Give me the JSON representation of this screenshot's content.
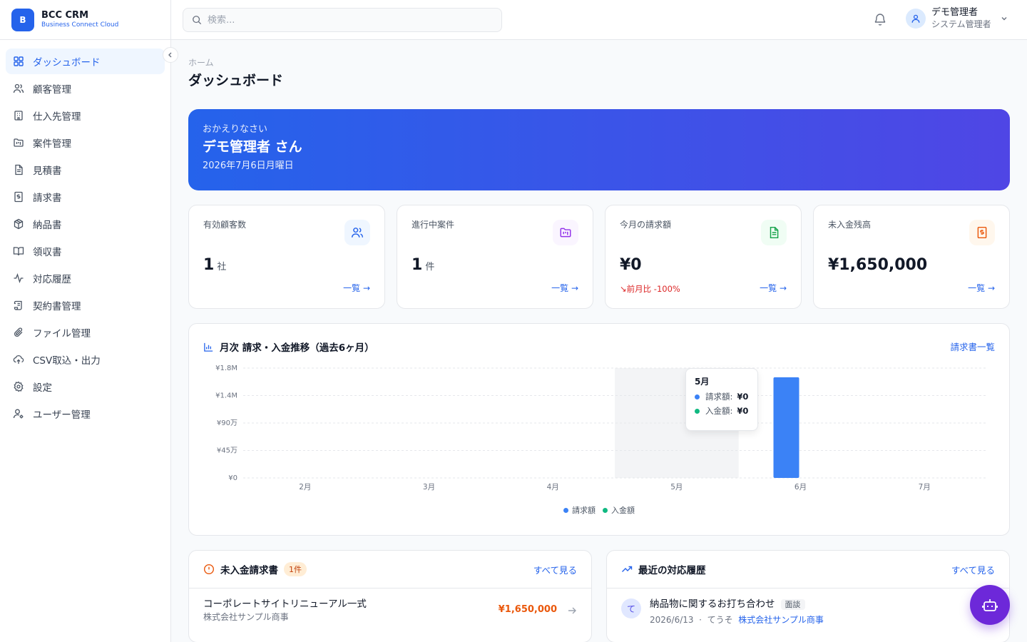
{
  "app": {
    "logo_letter": "B",
    "name": "BCC CRM",
    "subtitle": "Business Connect Cloud"
  },
  "search": {
    "placeholder": "検索..."
  },
  "user": {
    "name": "デモ管理者",
    "role": "システム管理者"
  },
  "sidebar": {
    "items": [
      {
        "label": "ダッシュボード",
        "icon": "dashboard-icon",
        "active": true
      },
      {
        "label": "顧客管理",
        "icon": "users-icon"
      },
      {
        "label": "仕入先管理",
        "icon": "building-icon"
      },
      {
        "label": "案件管理",
        "icon": "folder-kanban-icon"
      },
      {
        "label": "見積書",
        "icon": "file-text-icon"
      },
      {
        "label": "請求書",
        "icon": "receipt-icon"
      },
      {
        "label": "納品書",
        "icon": "package-icon"
      },
      {
        "label": "領収書",
        "icon": "book-open-icon"
      },
      {
        "label": "対応履歴",
        "icon": "activity-icon"
      },
      {
        "label": "契約書管理",
        "icon": "scroll-icon"
      },
      {
        "label": "ファイル管理",
        "icon": "paperclip-icon"
      },
      {
        "label": "CSV取込・出力",
        "icon": "upload-cloud-icon"
      },
      {
        "label": "設定",
        "icon": "gear-icon"
      },
      {
        "label": "ユーザー管理",
        "icon": "user-cog-icon"
      }
    ]
  },
  "breadcrumb": "ホーム",
  "page_title": "ダッシュボード",
  "welcome": {
    "greeting": "おかえりなさい",
    "name": "デモ管理者 さん",
    "date": "2026年7月6日月曜日"
  },
  "stats": [
    {
      "label": "有効顧客数",
      "value": "1",
      "unit": "社",
      "link": "一覧 →",
      "icon": "users-icon",
      "color": "#2563eb",
      "bg": "#eff6ff"
    },
    {
      "label": "進行中案件",
      "value": "1",
      "unit": "件",
      "link": "一覧 →",
      "icon": "folder-kanban-icon",
      "color": "#9333ea",
      "bg": "#faf5ff"
    },
    {
      "label": "今月の請求額",
      "value": "¥0",
      "unit": "",
      "delta": "↘前月比 -100%",
      "link": "一覧 →",
      "icon": "file-text-icon",
      "color": "#16a34a",
      "bg": "#f0fdf4"
    },
    {
      "label": "未入金残高",
      "value": "¥1,650,000",
      "unit": "",
      "link": "一覧 →",
      "icon": "receipt-icon",
      "color": "#ea580c",
      "bg": "#fff7ed"
    }
  ],
  "chart_card": {
    "title": "月次 請求・入金推移（過去6ヶ月）",
    "link": "請求書一覧"
  },
  "chart_data": {
    "type": "bar",
    "categories": [
      "2月",
      "3月",
      "4月",
      "5月",
      "6月",
      "7月"
    ],
    "series": [
      {
        "name": "請求額",
        "values": [
          0,
          0,
          0,
          0,
          1650000,
          0
        ],
        "color": "#3b82f6"
      },
      {
        "name": "入金額",
        "values": [
          0,
          0,
          0,
          0,
          0,
          0
        ],
        "color": "#10b981"
      }
    ],
    "yticks": [
      0,
      450000,
      900000,
      1350000,
      1800000
    ],
    "ytick_labels": [
      "¥0",
      "¥45万",
      "¥90万",
      "¥1.4M",
      "¥1.8M"
    ],
    "ylim": [
      0,
      1800000
    ],
    "grid": true,
    "legend": "bottom",
    "tooltip": {
      "category": "5月",
      "rows": [
        {
          "label": "請求額:",
          "value": "¥0"
        },
        {
          "label": "入金額:",
          "value": "¥0"
        }
      ]
    }
  },
  "unpaid": {
    "title": "未入金請求書",
    "count": "1件",
    "link": "すべて見る",
    "items": [
      {
        "title": "コーポレートサイトリニューアル一式",
        "company": "株式会社サンプル商事",
        "amount": "¥1,650,000"
      }
    ]
  },
  "activities": {
    "title": "最近の対応履歴",
    "link": "すべて見る",
    "items": [
      {
        "avatar": "て",
        "title": "納品物に関するお打ち合わせ",
        "type": "面談",
        "date": "2026/6/13",
        "user": "てうそ",
        "company": "株式会社サンプル商事"
      }
    ]
  }
}
